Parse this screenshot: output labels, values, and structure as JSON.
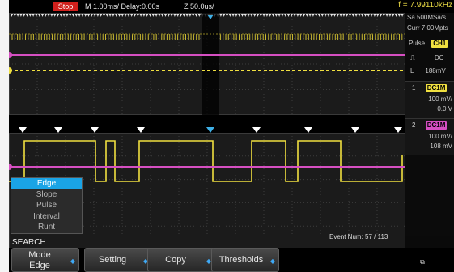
{
  "topbar": {
    "run_state": "Stop",
    "timebase": "M 1.00ms/ Delay:0.00s",
    "zoom_timebase": "Z 50.0us/",
    "frequency": "f = 7.99110kHz"
  },
  "side_panel": {
    "sample_rate": "Sa 500MSa/s",
    "memory_depth": "Curr 7.00Mpts",
    "trigger_type": "Pulse",
    "trigger_source": "CH1",
    "trigger_coupling": "DC",
    "trigger_level_prefix": "L",
    "trigger_level": "188mV",
    "ch1": {
      "number": "1",
      "coupling": "DC1M",
      "scale": "100 mV/",
      "offset": "0.0 V"
    },
    "ch2": {
      "number": "2",
      "coupling": "DC1M",
      "scale": "100 mV/",
      "offset": "108 mV"
    }
  },
  "event_num": "Event Num: 57 / 113",
  "search_menu": {
    "items": [
      "Edge",
      "Slope",
      "Pulse",
      "Interval",
      "Runt"
    ],
    "selected": "Edge"
  },
  "bottom": {
    "section_label": "SEARCH",
    "mode_label": "Mode",
    "mode_value": "Edge",
    "setting_label": "Setting",
    "copy_label": "Copy",
    "thresholds_label": "Thresholds"
  },
  "colors": {
    "ch1": "#f0e040",
    "ch2": "#d64fc2",
    "accent": "#1aa4e6",
    "stop": "#d0201c"
  }
}
